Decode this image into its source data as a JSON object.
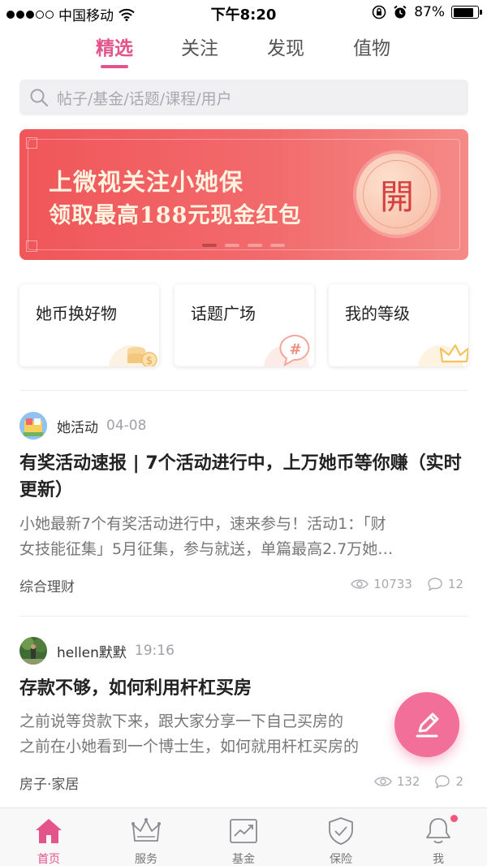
{
  "status_bar": {
    "carrier": "中国移动",
    "time": "下午8:20",
    "battery": "87%",
    "battery_level": 0.87
  },
  "top_tabs": [
    {
      "label": "精选",
      "active": true
    },
    {
      "label": "关注",
      "active": false
    },
    {
      "label": "发现",
      "active": false
    },
    {
      "label": "值物",
      "active": false
    }
  ],
  "search": {
    "placeholder": "帖子/基金/话题/课程/用户",
    "icon": "search-icon"
  },
  "banner": {
    "line1": "上微视关注小她保",
    "line2": "领取最高188元现金红包",
    "coin_char": "開",
    "page_count": 4,
    "active_page": 1
  },
  "quick_cards": [
    {
      "label": "她币换好物",
      "icon": "coin-stack-icon"
    },
    {
      "label": "话题广场",
      "icon": "hashtag-bubble-icon"
    },
    {
      "label": "我的等级",
      "icon": "crown-icon"
    }
  ],
  "posts": [
    {
      "author": "她活动",
      "date": "04-08",
      "title": "有奖活动速报 | 7个活动进行中，上万她币等你赚（实时更新）",
      "excerpt_line1": "小她最新7个有奖活动进行中，速来参与！活动1：「财",
      "excerpt_line2": "女技能征集」5月征集，参与就送，单篇最高2.7万她…",
      "tag": "综合理财",
      "views": "10733",
      "comments": "12"
    },
    {
      "author": "hellen默默",
      "date": "19:16",
      "title": "存款不够，如何利用杆杠买房",
      "excerpt_line1": "之前说等贷款下来，跟大家分享一下自己买房的",
      "excerpt_line2": "之前在小她看到一个博士生，如何就用杆杠买房的",
      "tag": "房子·家居",
      "views": "132",
      "comments": "2"
    }
  ],
  "fab": {
    "icon": "pencil-icon"
  },
  "bottom_nav": [
    {
      "label": "首页",
      "icon": "home-icon",
      "active": true
    },
    {
      "label": "服务",
      "icon": "crown-icon",
      "active": false
    },
    {
      "label": "基金",
      "icon": "chart-icon",
      "active": false
    },
    {
      "label": "保险",
      "icon": "shield-icon",
      "active": false
    },
    {
      "label": "我",
      "icon": "profile-bell-icon",
      "active": false,
      "has_badge": true
    }
  ],
  "colors": {
    "accent": "#e2548a",
    "banner": "#f0565a",
    "fab": "#f16f99"
  }
}
